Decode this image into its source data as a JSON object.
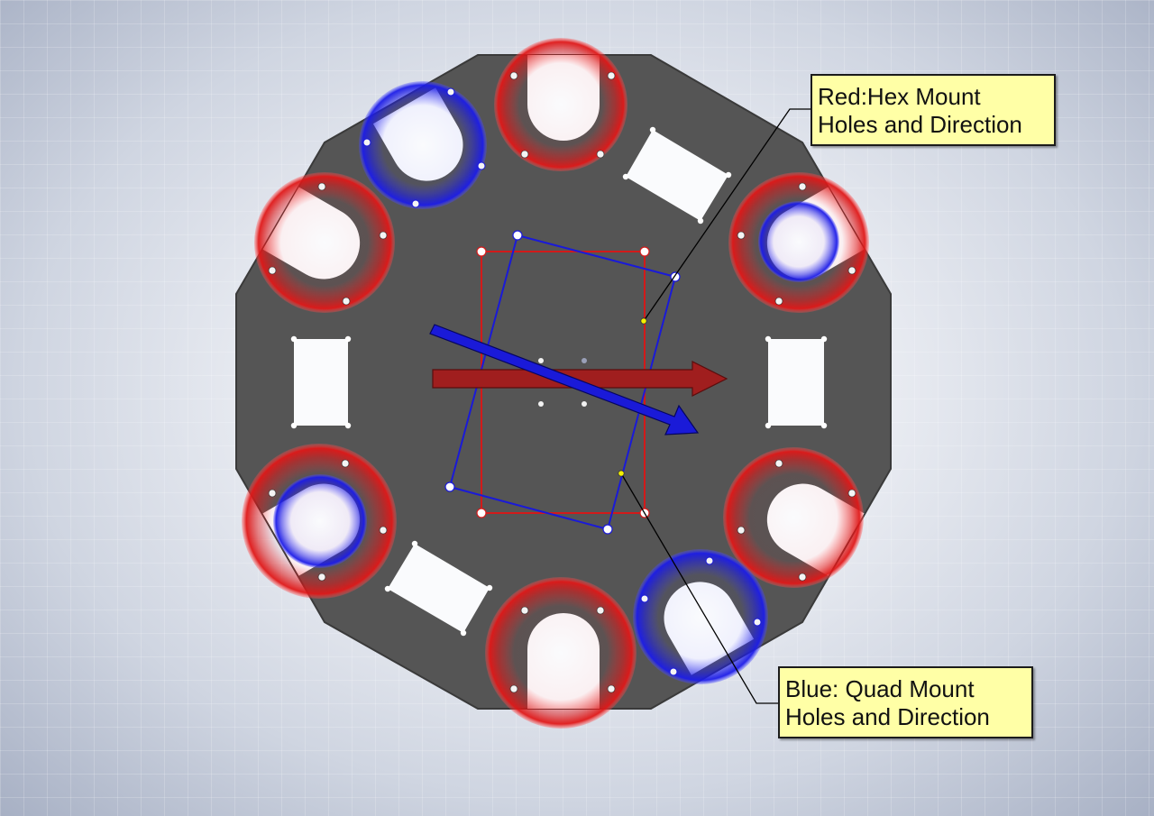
{
  "annotations": {
    "red": {
      "line1": "Red:Hex Mount",
      "line2": "Holes and Direction"
    },
    "blue": {
      "line1": "Blue: Quad Mount",
      "line2": "Holes and Direction"
    }
  },
  "colors": {
    "plate": "#555555",
    "hex_marker": "#d21a1a",
    "quad_marker": "#1a1ad8",
    "hex_arrow": "#a01e1e",
    "callout_fill": "#ffffa6",
    "leader_point": "#f4f000"
  },
  "icons": {
    "hex_direction": "arrow-right-icon",
    "quad_direction": "arrow-diagonal-icon"
  }
}
